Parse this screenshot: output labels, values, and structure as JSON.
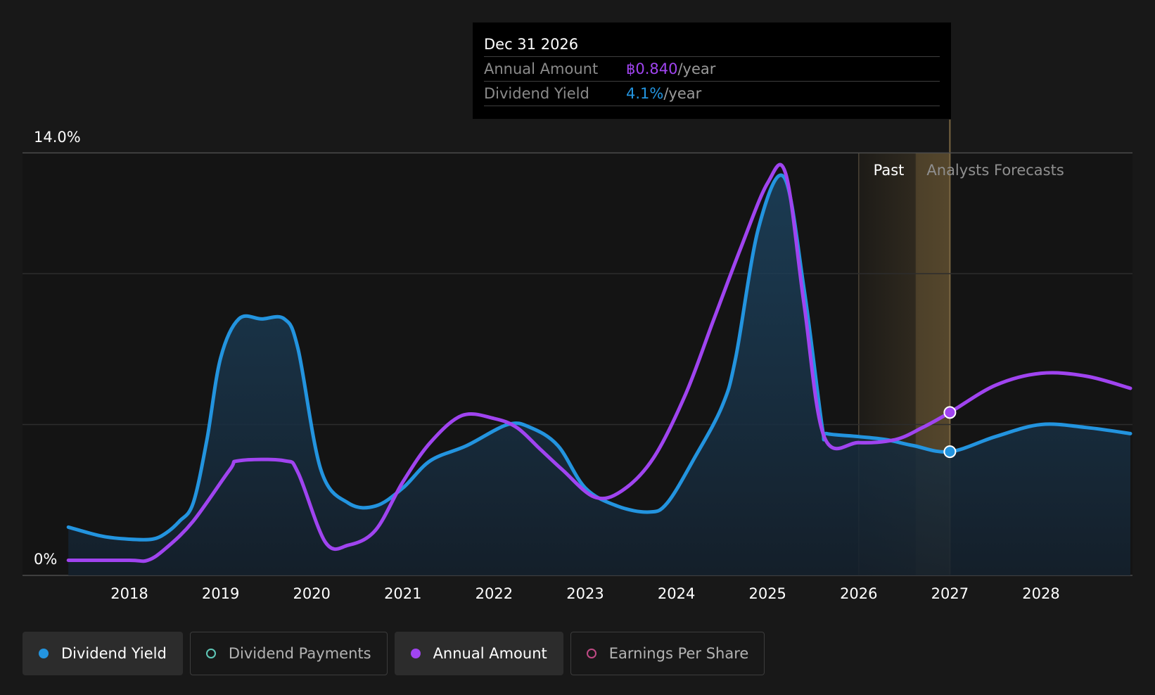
{
  "chart_data": {
    "type": "area",
    "y_axis": {
      "top_label": "14.0%",
      "bottom_label": "0%",
      "ylim": [
        0,
        14
      ]
    },
    "x_ticks": [
      "2018",
      "2019",
      "2020",
      "2021",
      "2022",
      "2023",
      "2024",
      "2025",
      "2026",
      "2027",
      "2028"
    ],
    "grid": true,
    "regions": {
      "past_label": "Past",
      "forecast_label": "Analysts Forecasts"
    },
    "series": [
      {
        "name": "Dividend Yield",
        "color": "#2394df",
        "fill": true,
        "points": [
          [
            2017.33,
            1.6
          ],
          [
            2017.7,
            1.3
          ],
          [
            2018.0,
            1.2
          ],
          [
            2018.25,
            1.2
          ],
          [
            2018.4,
            1.4
          ],
          [
            2018.55,
            1.8
          ],
          [
            2018.7,
            2.4
          ],
          [
            2018.85,
            4.5
          ],
          [
            2019.0,
            7.2
          ],
          [
            2019.2,
            8.5
          ],
          [
            2019.45,
            8.5
          ],
          [
            2019.7,
            8.5
          ],
          [
            2019.85,
            7.5
          ],
          [
            2020.1,
            3.5
          ],
          [
            2020.4,
            2.4
          ],
          [
            2020.7,
            2.3
          ],
          [
            2021.0,
            2.9
          ],
          [
            2021.3,
            3.8
          ],
          [
            2021.7,
            4.3
          ],
          [
            2022.15,
            5.0
          ],
          [
            2022.4,
            4.9
          ],
          [
            2022.7,
            4.3
          ],
          [
            2023.0,
            2.9
          ],
          [
            2023.35,
            2.3
          ],
          [
            2023.7,
            2.1
          ],
          [
            2023.9,
            2.4
          ],
          [
            2024.2,
            3.9
          ],
          [
            2024.5,
            5.6
          ],
          [
            2024.65,
            7.2
          ],
          [
            2024.9,
            11.5
          ],
          [
            2025.18,
            13.2
          ],
          [
            2025.4,
            9.5
          ],
          [
            2025.6,
            4.9
          ],
          [
            2025.65,
            4.7
          ],
          [
            2026.0,
            4.6
          ],
          [
            2026.3,
            4.5
          ],
          [
            2026.6,
            4.3
          ],
          [
            2027.0,
            4.1
          ],
          [
            2027.5,
            4.6
          ],
          [
            2028.0,
            5.0
          ],
          [
            2028.5,
            4.9
          ],
          [
            2028.98,
            4.7
          ]
        ]
      },
      {
        "name": "Annual Amount",
        "color": "#a044f0",
        "fill": false,
        "points": [
          [
            2017.33,
            0.5
          ],
          [
            2018.0,
            0.5
          ],
          [
            2018.2,
            0.5
          ],
          [
            2018.4,
            0.9
          ],
          [
            2018.7,
            1.8
          ],
          [
            2019.1,
            3.5
          ],
          [
            2019.2,
            3.8
          ],
          [
            2019.7,
            3.8
          ],
          [
            2019.85,
            3.4
          ],
          [
            2020.15,
            1.1
          ],
          [
            2020.4,
            1.0
          ],
          [
            2020.7,
            1.5
          ],
          [
            2021.0,
            3.1
          ],
          [
            2021.3,
            4.4
          ],
          [
            2021.65,
            5.3
          ],
          [
            2022.0,
            5.2
          ],
          [
            2022.25,
            4.9
          ],
          [
            2022.5,
            4.2
          ],
          [
            2022.75,
            3.5
          ],
          [
            2023.1,
            2.6
          ],
          [
            2023.4,
            2.8
          ],
          [
            2023.75,
            3.9
          ],
          [
            2024.1,
            6.0
          ],
          [
            2024.4,
            8.4
          ],
          [
            2024.7,
            10.8
          ],
          [
            2025.0,
            13.0
          ],
          [
            2025.2,
            13.3
          ],
          [
            2025.4,
            9.0
          ],
          [
            2025.62,
            4.6
          ],
          [
            2026.0,
            4.4
          ],
          [
            2026.4,
            4.5
          ],
          [
            2026.7,
            4.9
          ],
          [
            2027.0,
            5.4
          ],
          [
            2027.5,
            6.3
          ],
          [
            2028.0,
            6.7
          ],
          [
            2028.5,
            6.6
          ],
          [
            2028.98,
            6.2
          ]
        ]
      }
    ],
    "highlight": {
      "x": 2027.0,
      "yield": 4.1,
      "amount": 5.4
    },
    "past_region": {
      "from": 2026.0,
      "to": 2027.0
    }
  },
  "tooltip": {
    "date": "Dec 31 2026",
    "annual_amount_label": "Annual Amount",
    "annual_amount_value": "฿0.840",
    "annual_amount_suffix": "/year",
    "dividend_yield_label": "Dividend Yield",
    "dividend_yield_value": "4.1%",
    "dividend_yield_suffix": "/year",
    "amount_color": "#a044f0",
    "yield_color": "#2394df"
  },
  "legend": [
    {
      "label": "Dividend Yield",
      "color": "#2394df",
      "filled": true,
      "active": true
    },
    {
      "label": "Dividend Payments",
      "color": "#5fc8b8",
      "filled": false,
      "active": false
    },
    {
      "label": "Annual Amount",
      "color": "#a044f0",
      "filled": true,
      "active": true
    },
    {
      "label": "Earnings Per Share",
      "color": "#c04a85",
      "filled": false,
      "active": false
    }
  ]
}
